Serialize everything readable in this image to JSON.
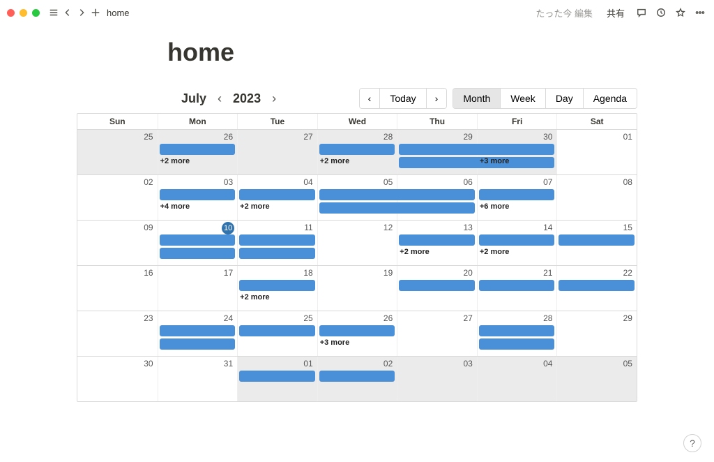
{
  "topbar": {
    "breadcrumb": "home",
    "status": "たった今 編集",
    "share": "共有"
  },
  "page": {
    "title": "home"
  },
  "calendar": {
    "month": "July",
    "year": "2023",
    "nav": {
      "today": "Today"
    },
    "views": {
      "month": "Month",
      "week": "Week",
      "day": "Day",
      "agenda": "Agenda"
    },
    "daysOfWeek": [
      "Sun",
      "Mon",
      "Tue",
      "Wed",
      "Thu",
      "Fri",
      "Sat"
    ],
    "todayDate": "10",
    "weeks": [
      {
        "days": [
          {
            "num": "25",
            "out": true
          },
          {
            "num": "26",
            "out": true
          },
          {
            "num": "27",
            "out": true
          },
          {
            "num": "28",
            "out": true
          },
          {
            "num": "29",
            "out": true
          },
          {
            "num": "30",
            "out": true
          },
          {
            "num": "01",
            "out": false
          }
        ],
        "events": [
          {
            "row": 0,
            "startCol": 1,
            "span": 1
          },
          {
            "row": 0,
            "startCol": 3,
            "span": 1
          },
          {
            "row": 0,
            "startCol": 4,
            "span": 2
          },
          {
            "row": 1,
            "startCol": 4,
            "span": 2
          },
          {
            "row": 0,
            "startCol": 5,
            "span": 1,
            "hidden": true
          }
        ],
        "more": [
          {
            "col": 1,
            "text": "+2 more"
          },
          {
            "col": 3,
            "text": "+2 more"
          },
          {
            "col": 5,
            "text": "+3 more"
          }
        ]
      },
      {
        "days": [
          {
            "num": "02"
          },
          {
            "num": "03"
          },
          {
            "num": "04"
          },
          {
            "num": "05"
          },
          {
            "num": "06"
          },
          {
            "num": "07"
          },
          {
            "num": "08"
          }
        ],
        "events": [
          {
            "row": 0,
            "startCol": 1,
            "span": 1
          },
          {
            "row": 0,
            "startCol": 2,
            "span": 1
          },
          {
            "row": 0,
            "startCol": 3,
            "span": 2
          },
          {
            "row": 1,
            "startCol": 3,
            "span": 2
          },
          {
            "row": 0,
            "startCol": 5,
            "span": 1
          }
        ],
        "more": [
          {
            "col": 1,
            "text": "+4 more"
          },
          {
            "col": 2,
            "text": "+2 more"
          },
          {
            "col": 5,
            "text": "+6 more"
          }
        ]
      },
      {
        "days": [
          {
            "num": "09"
          },
          {
            "num": "10",
            "today": true
          },
          {
            "num": "11"
          },
          {
            "num": "12"
          },
          {
            "num": "13"
          },
          {
            "num": "14"
          },
          {
            "num": "15"
          }
        ],
        "events": [
          {
            "row": 0,
            "startCol": 1,
            "span": 1
          },
          {
            "row": 1,
            "startCol": 1,
            "span": 1
          },
          {
            "row": 0,
            "startCol": 2,
            "span": 1
          },
          {
            "row": 1,
            "startCol": 2,
            "span": 1
          },
          {
            "row": 0,
            "startCol": 4,
            "span": 1
          },
          {
            "row": 0,
            "startCol": 5,
            "span": 1
          },
          {
            "row": 0,
            "startCol": 6,
            "span": 1
          }
        ],
        "more": [
          {
            "col": 4,
            "text": "+2 more"
          },
          {
            "col": 5,
            "text": "+2 more"
          }
        ]
      },
      {
        "days": [
          {
            "num": "16"
          },
          {
            "num": "17"
          },
          {
            "num": "18"
          },
          {
            "num": "19"
          },
          {
            "num": "20"
          },
          {
            "num": "21"
          },
          {
            "num": "22"
          }
        ],
        "events": [
          {
            "row": 0,
            "startCol": 2,
            "span": 1
          },
          {
            "row": 0,
            "startCol": 4,
            "span": 1
          },
          {
            "row": 0,
            "startCol": 5,
            "span": 1
          },
          {
            "row": 0,
            "startCol": 6,
            "span": 1
          }
        ],
        "more": [
          {
            "col": 2,
            "text": "+2 more"
          }
        ]
      },
      {
        "days": [
          {
            "num": "23"
          },
          {
            "num": "24"
          },
          {
            "num": "25"
          },
          {
            "num": "26"
          },
          {
            "num": "27"
          },
          {
            "num": "28"
          },
          {
            "num": "29"
          }
        ],
        "events": [
          {
            "row": 0,
            "startCol": 1,
            "span": 1
          },
          {
            "row": 1,
            "startCol": 1,
            "span": 1
          },
          {
            "row": 0,
            "startCol": 2,
            "span": 1
          },
          {
            "row": 0,
            "startCol": 3,
            "span": 1
          },
          {
            "row": 0,
            "startCol": 5,
            "span": 1
          },
          {
            "row": 1,
            "startCol": 5,
            "span": 1
          }
        ],
        "more": [
          {
            "col": 3,
            "text": "+3 more"
          }
        ]
      },
      {
        "days": [
          {
            "num": "30"
          },
          {
            "num": "31"
          },
          {
            "num": "01",
            "out": true
          },
          {
            "num": "02",
            "out": true
          },
          {
            "num": "03",
            "out": true
          },
          {
            "num": "04",
            "out": true
          },
          {
            "num": "05",
            "out": true
          }
        ],
        "events": [
          {
            "row": 0,
            "startCol": 2,
            "span": 1
          },
          {
            "row": 0,
            "startCol": 3,
            "span": 1
          }
        ],
        "more": []
      }
    ]
  },
  "help": {
    "label": "?"
  }
}
